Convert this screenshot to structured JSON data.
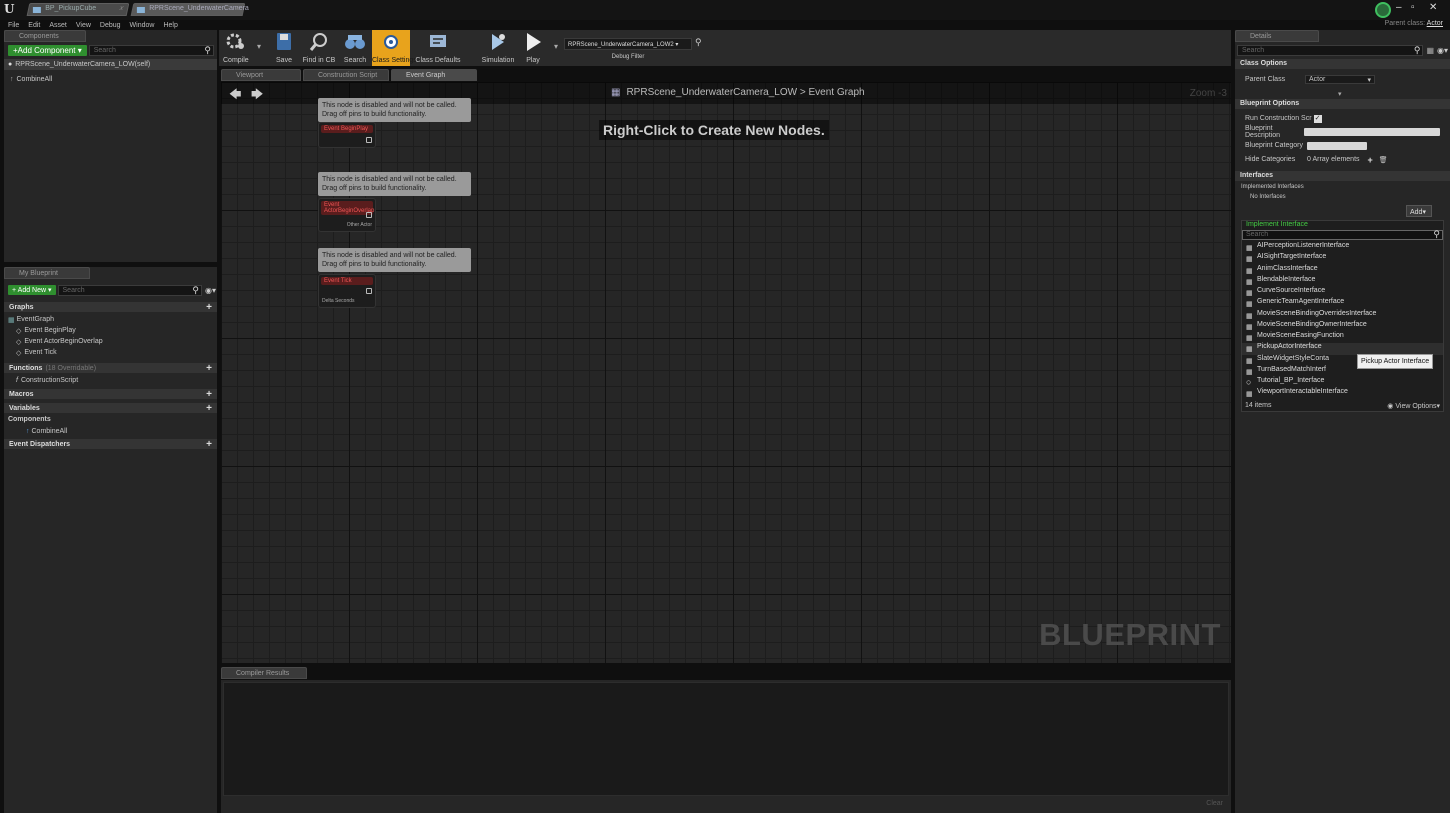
{
  "titlebar": {
    "tabs": [
      "BP_PickupCube",
      "RPRScene_UnderwaterCamera"
    ],
    "parent_class_label": "Parent class:",
    "parent_class_value": "Actor"
  },
  "menu": [
    "File",
    "Edit",
    "Asset",
    "View",
    "Debug",
    "Window",
    "Help"
  ],
  "components": {
    "tab": "Components",
    "add_button": "+Add Component ▾",
    "search_placeholder": "Search",
    "self_item": "RPRScene_UnderwaterCamera_LOW(self)",
    "child_item": "CombineAll"
  },
  "my_blueprint": {
    "tab": "My Blueprint",
    "add_button": "+ Add New ▾",
    "search_placeholder": "Search",
    "graphs_header": "Graphs",
    "event_graph": "EventGraph",
    "events": [
      "Event BeginPlay",
      "Event ActorBeginOverlap",
      "Event Tick"
    ],
    "functions_header": "Functions",
    "functions_count": "(18 Overridable)",
    "construction_script": "ConstructionScript",
    "macros_header": "Macros",
    "variables_header": "Variables",
    "components_header": "Components",
    "component_item": "CombineAll",
    "dispatchers_header": "Event Dispatchers"
  },
  "toolbar": {
    "compile": "Compile",
    "save": "Save",
    "find_in_cb": "Find in CB",
    "search": "Search",
    "class_settings": "Class Settings",
    "class_defaults": "Class Defaults",
    "simulation": "Simulation",
    "play": "Play",
    "debug_object": "RPRScene_UnderwaterCamera_LOW2 ▾",
    "debug_filter": "Debug Filter"
  },
  "editor_tabs": [
    "Viewport",
    "Construction Script",
    "Event Graph"
  ],
  "graph": {
    "breadcrumb": "RPRScene_UnderwaterCamera_LOW > Event Graph",
    "zoom": "Zoom -3",
    "hint": "Right-Click to Create New Nodes.",
    "watermark": "BLUEPRINT",
    "disabled_text_1": "This node is disabled and will not be called.",
    "disabled_text_2": "Drag off pins to build functionality.",
    "nodes": [
      {
        "title": "Event BeginPlay",
        "pin": ""
      },
      {
        "title": "Event ActorBeginOverlap",
        "pin": "Other Actor"
      },
      {
        "title": "Event Tick",
        "pin": "Delta Seconds"
      }
    ]
  },
  "compiler": {
    "tab": "Compiler Results",
    "clear": "Clear"
  },
  "details": {
    "tab": "Details",
    "search_placeholder": "Search",
    "class_options_header": "Class Options",
    "parent_class_label": "Parent Class",
    "parent_class_value": "Actor",
    "blueprint_options_header": "Blueprint Options",
    "run_construction_label": "Run Construction Scr",
    "blueprint_description_label": "Blueprint Description",
    "blueprint_category_label": "Blueprint Category",
    "hide_categories_label": "Hide Categories",
    "hide_categories_value": "0 Array elements",
    "interfaces_header": "Interfaces",
    "implemented_interfaces": "Implemented Interfaces",
    "no_interfaces": "No Interfaces",
    "add_button": "Add▾"
  },
  "interface_picker": {
    "header": "Implement Interface",
    "search_placeholder": "Search",
    "items": [
      "AIPerceptionListenerInterface",
      "AISightTargetInterface",
      "AnimClassInterface",
      "BlendableInterface",
      "CurveSourceInterface",
      "GenericTeamAgentInterface",
      "MovieSceneBindingOverridesInterface",
      "MovieSceneBindingOwnerInterface",
      "MovieSceneEasingFunction",
      "PickupActorInterface",
      "SlateWidgetStyleConta",
      "TurnBasedMatchInterf",
      "Tutorial_BP_Interface",
      "ViewportInteractableInterface"
    ],
    "count": "14 items",
    "view_options": "View Options▾",
    "tooltip": "Pickup Actor Interface"
  },
  "colors": {
    "accent_orange": "#e8a31c",
    "green": "#2f8f2f",
    "header_green": "#44cc44",
    "event_red": "#e55555"
  }
}
